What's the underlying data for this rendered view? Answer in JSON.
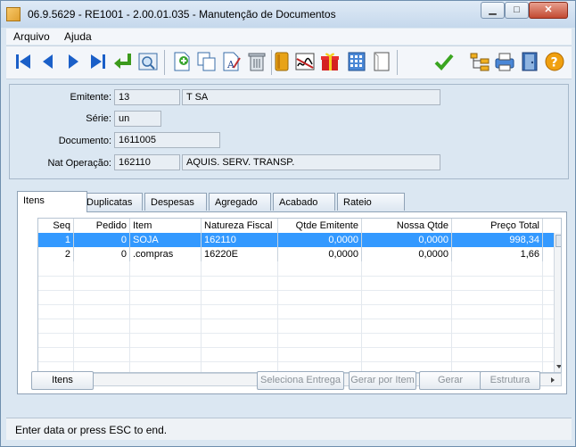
{
  "window": {
    "title": "06.9.5629 - RE1001 - 2.00.01.035 - Manutenção de Documentos",
    "min_symbol": "▁",
    "max_symbol": "□",
    "close_symbol": "✕"
  },
  "menu": {
    "items": [
      "Arquivo",
      "Ajuda"
    ]
  },
  "toolbar": {
    "buttons": [
      "first-icon",
      "prev-icon",
      "next-icon",
      "last-icon",
      "return-icon",
      "zoom-icon",
      "add-icon",
      "copy-icon",
      "edit-icon",
      "delete-icon",
      "book-icon",
      "signature-icon",
      "gift-icon",
      "calculator-icon",
      "blank-page-icon",
      "confirm-icon",
      "tree-icon",
      "print-icon",
      "exit-icon",
      "help-icon"
    ]
  },
  "form": {
    "emitente_label": "Emitente:",
    "emitente_code": "13",
    "emitente_name": "T SA",
    "serie_label": "Série:",
    "serie": "un",
    "documento_label": "Documento:",
    "documento": "1611005",
    "nat_label": "Nat Operação:",
    "nat_code": "162110",
    "nat_desc": "AQUIS. SERV. TRANSP."
  },
  "tabs": [
    "Itens",
    "Duplicatas",
    "Despesas",
    "Agregado",
    "Acabado",
    "Rateio"
  ],
  "grid": {
    "columns": [
      "Seq",
      "Pedido",
      "Item",
      "Natureza Fiscal",
      "Qtde Emitente",
      "Nossa Qtde",
      "Preço Total"
    ],
    "rows": [
      [
        "1",
        "0",
        "SOJA",
        "162110",
        "0,0000",
        "0,0000",
        "998,34"
      ],
      [
        "2",
        "0",
        ".compras",
        "16220E",
        "0,0000",
        "0,0000",
        "1,66"
      ]
    ]
  },
  "buttons": {
    "itens": "Itens",
    "seleciona_entrega": "Seleciona Entrega",
    "gerar_por_item": "Gerar por Item",
    "gerar": "Gerar",
    "estrutura": "Estrutura"
  },
  "status": {
    "text": "Enter data or press ESC to end."
  }
}
